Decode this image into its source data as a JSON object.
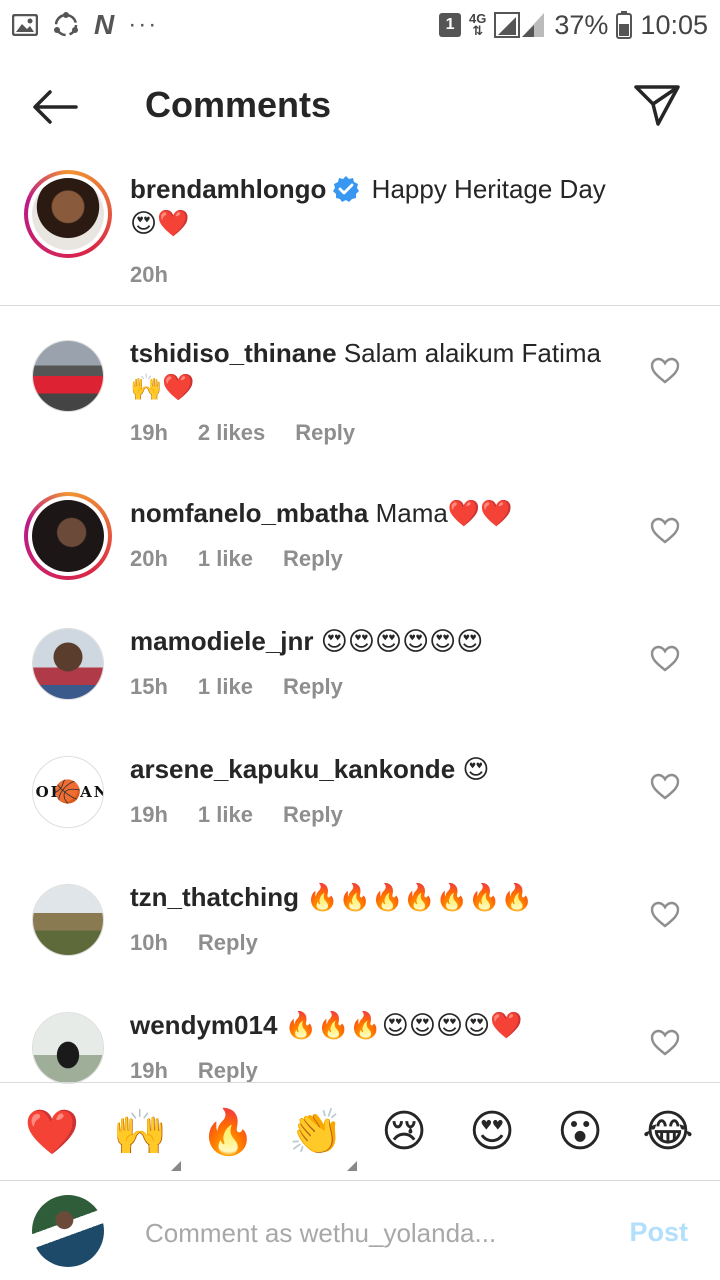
{
  "status_bar": {
    "sim_slot": "1",
    "network": "4G",
    "battery_percent": "37%",
    "time": "10:05",
    "more_dots": "···",
    "n_app": "N"
  },
  "header": {
    "title": "Comments"
  },
  "caption": {
    "username": "brendamhlongo",
    "verified": true,
    "text": "Happy Heritage Day 😍❤️",
    "time": "20h"
  },
  "comments": [
    {
      "username": "tshidiso_thinane",
      "text": "Salam alaikum Fatima 🙌❤️",
      "time": "19h",
      "likes": "2 likes",
      "reply": "Reply"
    },
    {
      "username": "nomfanelo_mbatha",
      "text": "Mama❤️❤️",
      "time": "20h",
      "likes": "1 like",
      "reply": "Reply"
    },
    {
      "username": "mamodiele_jnr",
      "text": "😍😍😍😍😍😍",
      "time": "15h",
      "likes": "1 like",
      "reply": "Reply"
    },
    {
      "username": "arsene_kapuku_kankonde",
      "text": "😍",
      "time": "19h",
      "likes": "1 like",
      "reply": "Reply"
    },
    {
      "username": "tzn_thatching",
      "text": "🔥🔥🔥🔥🔥🔥🔥",
      "time": "10h",
      "likes": "",
      "reply": "Reply"
    },
    {
      "username": "wendym014",
      "text": "🔥🔥🔥😍😍😍😍❤️",
      "time": "19h",
      "likes": "",
      "reply": "Reply"
    }
  ],
  "avatar_labels": {
    "jordan": "JORDAN"
  },
  "emoji_bar": [
    "❤️",
    "🙌",
    "🔥",
    "👏",
    "😢",
    "😍",
    "😮",
    "😂"
  ],
  "composer": {
    "placeholder": "Comment as wethu_yolanda...",
    "post_label": "Post"
  },
  "colors": {
    "accent_verified": "#3897f0",
    "post_disabled": "#b2dffc",
    "meta_gray": "#8e8e8e"
  }
}
